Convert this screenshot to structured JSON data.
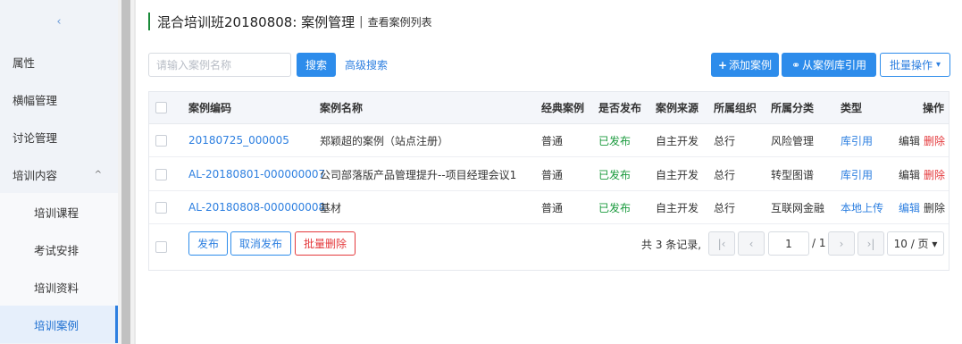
{
  "sidebar": {
    "collapse_icon": "chevron-left-icon",
    "collapse_glyph": "‹",
    "items": [
      {
        "label": "属性"
      },
      {
        "label": "横幅管理"
      },
      {
        "label": "讨论管理"
      },
      {
        "label": "培训内容",
        "expand_glyph": "^"
      }
    ],
    "sub_items": [
      {
        "label": "培训课程"
      },
      {
        "label": "考试安排"
      },
      {
        "label": "培训资料"
      },
      {
        "label": "培训案例",
        "active": true
      }
    ]
  },
  "header": {
    "title": "混合培训班20180808: 案例管理",
    "separator": "|",
    "subtitle": "查看案例列表"
  },
  "toolbar": {
    "search_placeholder": "请输入案例名称",
    "search_label": "搜索",
    "advanced_label": "高级搜索",
    "add_icon": "+",
    "add_label": "添加案例",
    "library_icon": "link-icon",
    "library_glyph": "⚭",
    "library_label": "从案例库引用",
    "batch_label": "批量操作",
    "batch_caret": "▾"
  },
  "table": {
    "columns": {
      "code": "案例编码",
      "name": "案例名称",
      "classic": "经典案例",
      "published": "是否发布",
      "source": "案例来源",
      "org": "所属组织",
      "category": "所属分类",
      "type": "类型",
      "ops": "操作"
    },
    "rows": [
      {
        "code": "20180725_000005",
        "name": "郑颖超的案例（站点注册）",
        "classic": "普通",
        "published": "已发布",
        "source": "自主开发",
        "org": "总行",
        "category": "风险管理",
        "type": "库引用",
        "edit": "编辑",
        "delete": "删除"
      },
      {
        "code": "AL-20180801-000000007",
        "name": "公司部落版产品管理提升--项目经理会议1",
        "classic": "普通",
        "published": "已发布",
        "source": "自主开发",
        "org": "总行",
        "category": "转型图谱",
        "type": "库引用",
        "edit": "编辑",
        "delete": "删除"
      },
      {
        "code": "AL-20180808-000000008",
        "name": "基材",
        "classic": "普通",
        "published": "已发布",
        "source": "自主开发",
        "org": "总行",
        "category": "互联网金融",
        "type": "本地上传",
        "edit": "编辑",
        "delete": "删除"
      }
    ]
  },
  "footer": {
    "publish_label": "发布",
    "unpublish_label": "取消发布",
    "batch_delete_label": "批量删除",
    "total_text": "共 3 条记录,",
    "first_glyph": "|‹",
    "prev_glyph": "‹",
    "next_glyph": "›",
    "last_glyph": "›|",
    "current_page": "1",
    "page_of": "/ 1",
    "page_size": "10 / 页 ▾"
  },
  "colors": {
    "primary": "#2d8ceb",
    "link": "#2d7fe0",
    "published": "#1b9a3e",
    "danger": "#e4393c",
    "title_accent": "#1a8a39"
  }
}
